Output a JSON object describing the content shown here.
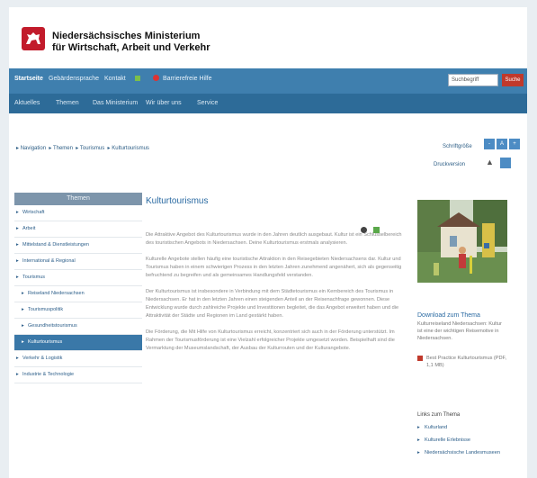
{
  "header": {
    "ministry_line1": "Niedersächsisches Ministerium",
    "ministry_line2": "für Wirtschaft, Arbeit und Verkehr",
    "brand_color": "#c21b2b"
  },
  "topnav": {
    "items": [
      "Startseite",
      "Gebärdensprache",
      "Kontakt",
      "Barrierefreie Hilfe"
    ],
    "search_placeholder": "Suchbegriff",
    "search_button": "Suche"
  },
  "mainnav": {
    "items": [
      "Aktuelles",
      "Themen",
      "Das Ministerium",
      "Wir über uns",
      "Service"
    ]
  },
  "breadcrumb": {
    "items": [
      "Navigation",
      "Themen",
      "Tourismus",
      "Kulturtourismus"
    ]
  },
  "tools": {
    "font_size_label": "Schriftgröße",
    "print_label": "Druckversion"
  },
  "sidebar": {
    "title": "Themen",
    "items": [
      {
        "label": "Wirtschaft",
        "sub": false,
        "active": false
      },
      {
        "label": "Arbeit",
        "sub": false,
        "active": false
      },
      {
        "label": "Mittelstand & Dienstleistungen",
        "sub": false,
        "active": false
      },
      {
        "label": "International & Regional",
        "sub": false,
        "active": false
      },
      {
        "label": "Tourismus",
        "sub": false,
        "active": false
      },
      {
        "label": "Reiseland Niedersachsen",
        "sub": true,
        "active": false
      },
      {
        "label": "Tourismuspolitik",
        "sub": true,
        "active": false
      },
      {
        "label": "Gesundheitstourismus",
        "sub": true,
        "active": false
      },
      {
        "label": "Kulturtourismus",
        "sub": true,
        "active": true
      },
      {
        "label": "Verkehr & Logistik",
        "sub": false,
        "active": false
      },
      {
        "label": "Industrie & Technologie",
        "sub": false,
        "active": false
      }
    ]
  },
  "content": {
    "title": "Kulturtourismus",
    "paragraphs": [
      "Die Attraktive Angebot des Kulturtourismus wurde in den Jahren deutlich ausgebaut. Kultur ist ein Schlüsselbereich des touristischen Angebots in Niedersachsen. Deine Kulturtourismus erstmals analysieren.",
      "Kulturelle Angebote stellen häufig eine touristische Attraktion in den Reisegebieten Niedersachsens dar. Kultur und Tourismus haben in einem schwierigen Prozess in den letzten Jahren zunehmend angenähert, sich als gegenseitig befruchtend zu begreifen und als gemeinsames Handlungsfeld verstanden.",
      "Der Kulturtourismus ist insbesondere in Verbindung mit dem Städtetourismus ein Kernbereich des Tourismus in Niedersachsen. Er hat in den letzten Jahren einen steigenden Anteil an der Reisenachfrage gewonnen. Diese Entwicklung wurde durch zahlreiche Projekte und Investitionen begleitet, die das Angebot erweitert haben und die Attraktivität der Städte und Regionen im Land gestärkt haben.",
      "Die Förderung, die Mit Hilfe von Kulturtourismus erreicht, konzentriert sich auch in der Förderung unterstützt. Im Rahmen der Tourismusförderung ist eine Vielzahl erfolgreicher Projekte umgesetzt worden. Beispielhaft sind die Vermarktung der Museumslandschaft, der Ausbau der Kulturrouten und der Kulturangebote."
    ]
  },
  "download": {
    "title": "Download zum Thema",
    "text": "Kulturreiseland Niedersachsen: Kultur ist eine der wichtigen Reisemotive in Niedersachsen.",
    "link_label": "Best Practice Kulturtourismus (PDF, 1,1 MB)"
  },
  "links": {
    "title": "Links zum Thema",
    "items": [
      "Kulturland",
      "Kulturelle Erlebnisse",
      "Niedersächsische Landesmuseen"
    ]
  }
}
